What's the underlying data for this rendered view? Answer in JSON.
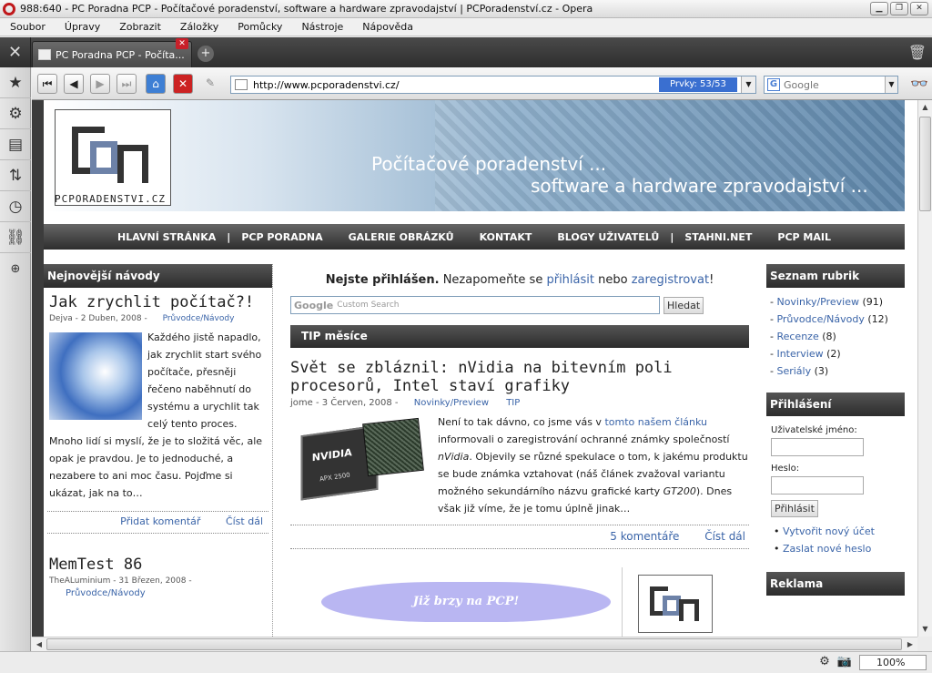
{
  "window": {
    "title": "988:640 - PC Poradna PCP - Počítačové poradenství, software a hardware zpravodajství | PCPoradenství.cz - Opera"
  },
  "menu": [
    "Soubor",
    "Úpravy",
    "Zobrazit",
    "Záložky",
    "Pomůcky",
    "Nástroje",
    "Nápověda"
  ],
  "tab": {
    "label": "PC Poradna PCP - Počíta..."
  },
  "address": {
    "url": "http://www.pcporadenstvi.cz/",
    "elements": "Prvky:   53/53",
    "search_placeholder": "Google"
  },
  "status": {
    "zoom": "100%"
  },
  "site": {
    "logo_text": "PCPORADENSTVI.CZ",
    "tagline1": "Počítačové poradenství ...",
    "tagline2": "software a hardware zpravodajství ...",
    "nav": [
      "HLAVNÍ STRÁNKA",
      "PCP PORADNA",
      "GALERIE OBRÁZKŮ",
      "KONTAKT",
      "BLOGY UŽIVATELŮ",
      "STAHNI.NET",
      "PCP MAIL"
    ]
  },
  "left": {
    "header": "Nejnovější návody",
    "a1": {
      "title": "Jak zrychlit počítač?!",
      "meta": "Dejva - 2 Duben, 2008 -",
      "category": "Průvodce/Návody",
      "body_wrap": "Každého jistě napadlo, jak zrychlit start svého počítače, přesněji řečeno naběhnutí do systému a urychlit tak celý tento proces.",
      "body_full": "Mnoho lidí si myslí, že je to složitá věc, ale opak je pravdou. Je to jednoduché, a nezabere to ani moc času. Pojďme si ukázat, jak na to…",
      "add_comment": "Přidat komentář",
      "read_more": "Číst dál"
    },
    "a2": {
      "title": "MemTest 86",
      "meta": "TheALuminium - 31 Březen, 2008 -",
      "category": "Průvodce/Návody"
    }
  },
  "center": {
    "login_bold": "Nejste přihlášen.",
    "login_mid": " Nezapomeňte se ",
    "login_link1": "přihlásit",
    "login_or": " nebo ",
    "login_link2": "zaregistrovat",
    "login_end": "!",
    "search_google": "Google",
    "search_placeholder": "Custom Search",
    "search_button": "Hledat",
    "tip_header": "TIP měsíce",
    "tip": {
      "title": "Svět se zbláznil: nVidia na bitevním poli procesorů, Intel staví grafiky",
      "meta": "jome - 3 Červen, 2008 -",
      "cat1": "Novinky/Preview",
      "cat2": "TIP",
      "p1": "Není to tak dávno, co jsme vás v ",
      "p1_link": "tomto našem článku",
      "p2": " informovali o zaregistrování ochranné známky společností ",
      "p2_italic": "nVidia",
      "p3": ". Objevily se různé spekulace o tom, k jakému produktu se bude známka vztahovat (náš článek zvažoval variantu možného sekundárního názvu grafické karty ",
      "p3_italic": "GT200",
      "p4": "). Dnes však již víme, že je tomu úplně jinak…",
      "chip_brand": "NVIDIA",
      "chip_model": "APX 2500",
      "comments": "5 komentáře",
      "read_more": "Číst dál"
    },
    "promo": "Již brzy na PCP!"
  },
  "right": {
    "rubrics_header": "Seznam rubrik",
    "rubrics": [
      {
        "name": "Novinky/Preview",
        "count": "(91)"
      },
      {
        "name": "Průvodce/Návody",
        "count": "(12)"
      },
      {
        "name": "Recenze",
        "count": "(8)"
      },
      {
        "name": "Interview",
        "count": "(2)"
      },
      {
        "name": "Seriály",
        "count": "(3)"
      }
    ],
    "login_header": "Přihlášení",
    "username_label": "Uživatelské jméno:",
    "password_label": "Heslo:",
    "login_button": "Přihlásit",
    "create_account": "Vytvořit nový účet",
    "send_password": "Zaslat nové heslo",
    "ad_header": "Reklama"
  }
}
